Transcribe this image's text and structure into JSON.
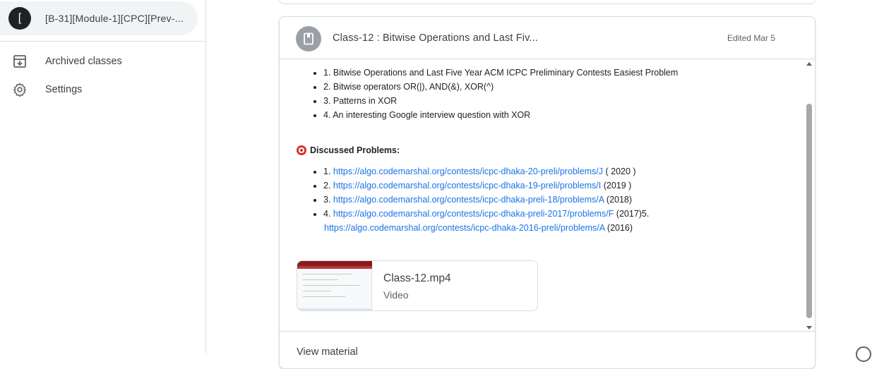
{
  "sidebar": {
    "class_item": {
      "avatar_letter": "[",
      "name": "[B-31][Module-1][CPC][Prev-..."
    },
    "archived_label": "Archived classes",
    "settings_label": "Settings"
  },
  "card": {
    "title": "Class-12 : Bitwise Operations and Last Fiv...",
    "edited": "Edited Mar 5",
    "topics": [
      "1.  Bitwise Operations and Last Five Year ACM ICPC Preliminary Contests Easiest Problem",
      "2.  Bitwise operators OR(|), AND(&), XOR(^)",
      "3.  Patterns in XOR",
      "4.  An interesting Google interview question with XOR"
    ],
    "problems_heading": "Discussed Problems:",
    "problems": [
      {
        "prefix": "1. ",
        "url": "https://algo.codemarshal.org/contests/icpc-dhaka-20-preli/problems/J",
        "suffix": " ( 2020 )"
      },
      {
        "prefix": "2.  ",
        "url": "https://algo.codemarshal.org/contests/icpc-dhaka-19-preli/problems/I",
        "suffix": " (2019 )"
      },
      {
        "prefix": "3.  ",
        "url": "https://algo.codemarshal.org/contests/icpc-dhaka-preli-18/problems/A",
        "suffix": " (2018)"
      },
      {
        "prefix": "4.  ",
        "url": "https://algo.codemarshal.org/contests/icpc-dhaka-preli-2017/problems/F",
        "suffix": " (2017)5."
      }
    ],
    "continuation": {
      "url": "https://algo.codemarshal.org/contests/icpc-dhaka-2016-preli/problems/A",
      "suffix": " (2016)"
    },
    "attachment": {
      "name": "Class-12.mp4",
      "type": "Video"
    },
    "view_material": "View material"
  },
  "colors": {
    "link": "#1a73e8",
    "chip_bg": "#f1f3f4"
  }
}
